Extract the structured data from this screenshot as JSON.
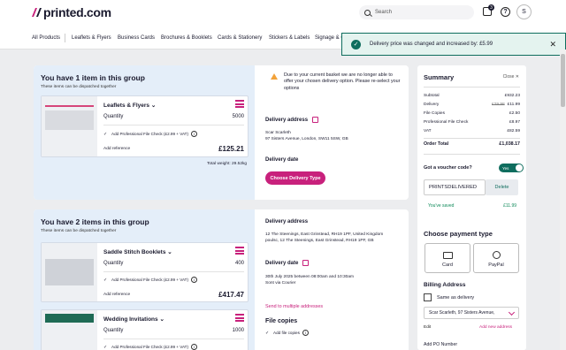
{
  "header": {
    "logo_text": "printed.com",
    "search_placeholder": "Search",
    "basket_count": "3",
    "help_symbol": "?",
    "avatar_initial": "S"
  },
  "nav": {
    "items": [
      "All Products",
      "Leaflets & Flyers",
      "Business Cards",
      "Brochures & Booklets",
      "Cards & Stationery",
      "Stickers & Labels",
      "Signage & C"
    ]
  },
  "toast": {
    "message": "Delivery price was changed and increased by: £5.99",
    "check": "✓",
    "close": "✕"
  },
  "group1": {
    "title": "You have 1 item in this group",
    "subtitle": "These items can be dispatched together",
    "product": {
      "name": "Leaflets & Flyers",
      "quantity_label": "Quantity",
      "quantity": "5000",
      "file_check": "Add Professional File Check (£2.99 + VAT)",
      "add_reference": "Add reference",
      "price": "£125.21"
    },
    "total_weight": "Total weight: 29.52kg",
    "warning": "Due to your current basket we are no longer able to offer your chosen delivery option. Please re-select your options",
    "delivery_address_label": "Delivery address",
    "address_name": "Scar Scarleth",
    "address_line": "97 Sisters Avenue, London, SW11 5SW, GB",
    "delivery_date_label": "Delivery date",
    "choose_delivery_button": "Choose Delivery Type"
  },
  "group2": {
    "title": "You have 2 items in this group",
    "subtitle": "These items can be dispatched together",
    "product1": {
      "name": "Saddle Stitch Booklets",
      "quantity_label": "Quantity",
      "quantity": "400",
      "file_check": "Add Professional File Check (£2.99 + VAT)",
      "add_reference": "Add reference",
      "price": "£417.47"
    },
    "product2": {
      "name": "Wedding Invitations",
      "quantity_label": "Quantity",
      "quantity": "1000",
      "file_check": "Add Professional File Check (£2.99 + VAT)"
    },
    "delivery_address_label": "Delivery address",
    "address_line1": "12 The Steenings, East Grinstead, RH19 1PF, United Kingdom",
    "address_line2": "poulsc, 12 The Steenings, East Grinstead, RH19 1PF, GB",
    "delivery_date_label": "Delivery date",
    "date_line1": "30th July 2025 between 08:00am and 10:30am",
    "date_line2": "Sont via Courier",
    "send_multiple": "Send to multiple addresses",
    "file_copies_title": "File copies",
    "add_file_copies": "Add file copies"
  },
  "summary": {
    "title": "Summary",
    "close_label": "Close",
    "rows": [
      {
        "label": "Subtotal",
        "old": "",
        "value": "£932.23"
      },
      {
        "label": "Delivery",
        "old": "£29.98",
        "value": "£11.99"
      },
      {
        "label": "File Copies",
        "old": "",
        "value": "£2.50"
      },
      {
        "label": "Professional File Check",
        "old": "",
        "value": "£8.97"
      },
      {
        "label": "VAT",
        "old": "",
        "value": "£82.59"
      }
    ],
    "order_total_label": "Order Total",
    "order_total": "£1,038.17",
    "voucher_question": "Got a voucher code?",
    "toggle_label": "Yes",
    "voucher_code": "PRINTSDELIVERED",
    "delete_label": "Delete",
    "saved_label": "You've saved",
    "saved_value": "£11.99"
  },
  "payment": {
    "title": "Choose payment type",
    "card_label": "Card",
    "paypal_label": "PayPal",
    "billing_title": "Billing Address",
    "same_as_delivery": "Same as delivery",
    "address_selected": "Scar Scarleth, 97 Sisters Avenue,",
    "edit_label": "Edit",
    "add_new_address": "Add new address",
    "po_label": "Add PO Number"
  }
}
